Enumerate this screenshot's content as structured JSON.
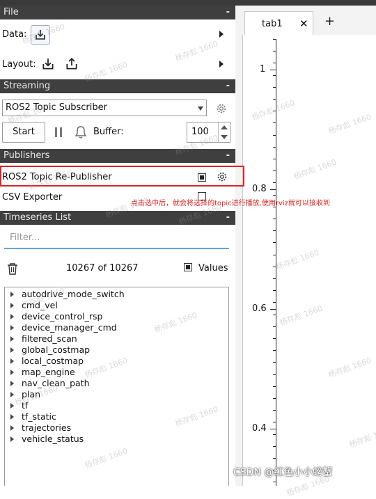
{
  "file": {
    "header": "File",
    "collapse": "-",
    "data_label": "Data:",
    "layout_label": "Layout:"
  },
  "streaming": {
    "header": "Streaming",
    "collapse": "-",
    "subscriber": "ROS2 Topic Subscriber",
    "start_label": "Start",
    "buffer_label": "Buffer:",
    "buffer_value": "100"
  },
  "publishers": {
    "header": "Publishers",
    "collapse": "-",
    "items": [
      {
        "label": "ROS2 Topic Re-Publisher",
        "checked": true
      },
      {
        "label": "CSV Exporter",
        "checked": false
      }
    ],
    "annotation": "点击选中后，就会将选择的topic进行播放,使用rviz就可以接收到"
  },
  "timeseries": {
    "header": "Timeseries List",
    "collapse": "-",
    "filter_placeholder": "Filter...",
    "count": "10267 of 10267",
    "values_label": "Values",
    "topics": [
      "autodrive_mode_switch",
      "cmd_vel",
      "device_control_rsp",
      "device_manager_cmd",
      "filtered_scan",
      "global_costmap",
      "local_costmap",
      "map_engine",
      "nav_clean_path",
      "plan",
      "tf",
      "tf_static",
      "trajectories",
      "vehicle_status"
    ]
  },
  "plot": {
    "tab_label": "tab1",
    "tab_close": "✕",
    "tab_add": "+",
    "y_ticks": [
      "1",
      "0.8",
      "0.6",
      "0.4"
    ]
  },
  "watermark_text": "杨存彪 1660",
  "csdn_watermark": "CSDN @红色小小螃蟹"
}
